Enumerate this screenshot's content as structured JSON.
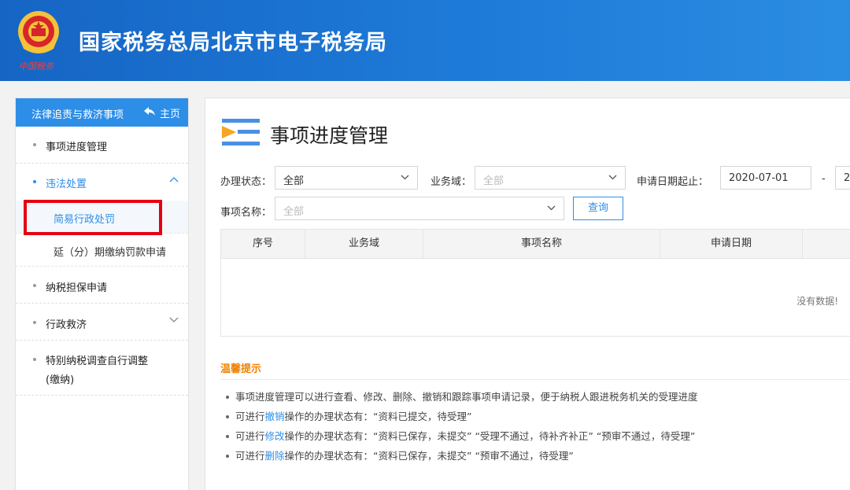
{
  "header": {
    "title": "国家税务总局北京市电子税务局",
    "emblem_text": "中国税务"
  },
  "sidebar": {
    "title": "法律追责与救济事项",
    "home_label": "主页",
    "items": [
      {
        "label": "事项进度管理"
      },
      {
        "label": "违法处置",
        "expanded": true
      },
      {
        "label": "纳税担保申请"
      },
      {
        "label": "行政救济"
      },
      {
        "label": "特别纳税调查自行调整",
        "label_line2": "(缴纳)"
      }
    ],
    "subitems": [
      {
        "label": "简易行政处罚"
      },
      {
        "label": "延（分）期缴纳罚款申请"
      }
    ]
  },
  "main": {
    "title": "事项进度管理",
    "filters": {
      "status_label": "办理状态：",
      "status_value": "全部",
      "domain_label": "业务域：",
      "domain_placeholder": "全部",
      "date_label": "申请日期起止：",
      "date_from": "2020-07-01",
      "date_sep": "-",
      "date_to_partial": "2",
      "name_label": "事项名称：",
      "name_placeholder": "全部",
      "query_button": "查询"
    },
    "table": {
      "columns": [
        "序号",
        "业务域",
        "事项名称",
        "申请日期"
      ],
      "empty_text": "没有数据!"
    },
    "tips": {
      "title": "温馨提示",
      "items": [
        {
          "prefix": "事项进度管理可以进行查看、修改、删除、撤销和跟踪事项申请记录，便于纳税人跟进税务机关的受理进度",
          "link": "",
          "suffix": ""
        },
        {
          "prefix": "可进行",
          "link": "撤销",
          "suffix": "操作的办理状态有：“资料已提交，待受理”"
        },
        {
          "prefix": "可进行",
          "link": "修改",
          "suffix": "操作的办理状态有：“资料已保存，未提交”  “受理不通过，待补齐补正”  “预审不通过，待受理”"
        },
        {
          "prefix": "可进行",
          "link": "删除",
          "suffix": "操作的办理状态有：“资料已保存，未提交”  “预审不通过，待受理”"
        }
      ]
    }
  },
  "colors": {
    "header_blue": "#1e7ad8",
    "accent_blue": "#2d8ee8",
    "highlight_red": "#e60012",
    "tips_orange": "#f08300"
  }
}
